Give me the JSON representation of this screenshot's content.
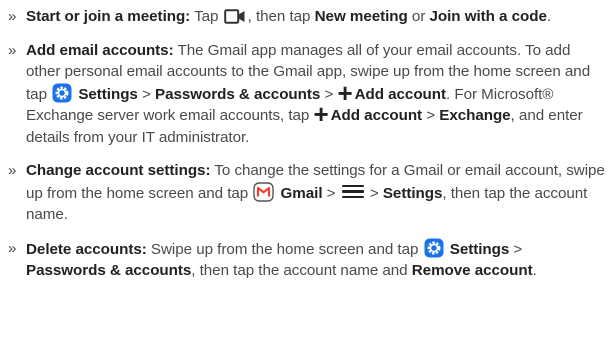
{
  "bullet": "»",
  "items": [
    {
      "term": "Start or join a meeting:",
      "t1": " Tap ",
      "icon": "video-camera-icon",
      "t2": ", then tap ",
      "b1": "New meeting",
      "t3": " or ",
      "b2": "Join with a code",
      "t4": "."
    },
    {
      "term": "Add email accounts:",
      "t1": " The Gmail app manages all of your email accounts. To add other personal email accounts to the Gmail app, swipe up from the home screen and tap ",
      "settings_icon": "settings-gear-icon",
      "b1": "Settings",
      "t2": " > ",
      "b2": "Passwords & accounts",
      "t3": " > ",
      "plus_icon": "plus-icon",
      "b3": "Add account",
      "t4": ". For Microsoft® Exchange server work email accounts, tap ",
      "b4": "Add account",
      "t5": " > ",
      "b5": "Exchange",
      "t6": ", and enter details from your IT administrator."
    },
    {
      "term": "Change account settings:",
      "t1": " To change the settings for a Gmail or email account, swipe up from the home screen and tap ",
      "gmail_icon": "gmail-icon",
      "b1": "Gmail",
      "t2": " > ",
      "menu_icon": "menu-icon",
      "t3": " > ",
      "b2": "Settings",
      "t4": ", then tap the account name."
    },
    {
      "term": "Delete accounts:",
      "t1": " Swipe up from the home screen and tap ",
      "settings_icon": "settings-gear-icon",
      "b1": "Settings",
      "t2": " > ",
      "b2": "Passwords & accounts",
      "t3": ", then tap the account name and ",
      "b3": "Remove account",
      "t4": "."
    }
  ],
  "colors": {
    "text": "#4a4a4a",
    "bold": "#222222",
    "settings_icon": "#1a73e8",
    "gmail_red": "#ea4335"
  }
}
